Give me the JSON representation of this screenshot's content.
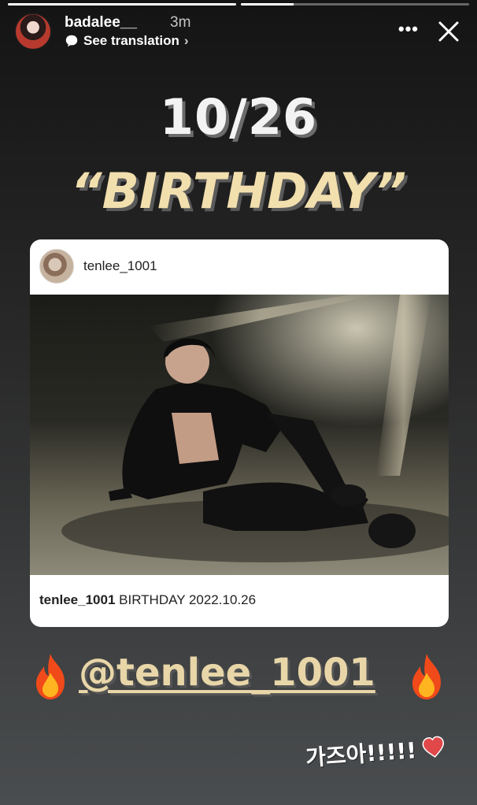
{
  "story": {
    "progress": [
      1.0,
      0.23
    ],
    "username": "badalee__",
    "time_ago": "3m",
    "translation_label": "See translation",
    "more_label": "•••"
  },
  "headline": {
    "date": "10/26",
    "title": "“BIRTHDAY”"
  },
  "post": {
    "username": "tenlee_1001",
    "caption_user": "tenlee_1001",
    "caption_text": "BIRTHDAY 2022.10.26"
  },
  "mention": {
    "handle": "@tenlee_1001"
  },
  "sticker": {
    "text": "가즈아!!!!!"
  },
  "colors": {
    "headline_date": "#f3f3f3",
    "headline_title": "#f2dfae",
    "mention": "#e8d6a8",
    "card": "#ffffff"
  },
  "icons": [
    "translate-icon",
    "more-icon",
    "close-icon",
    "fire-icon",
    "heart-icon"
  ]
}
